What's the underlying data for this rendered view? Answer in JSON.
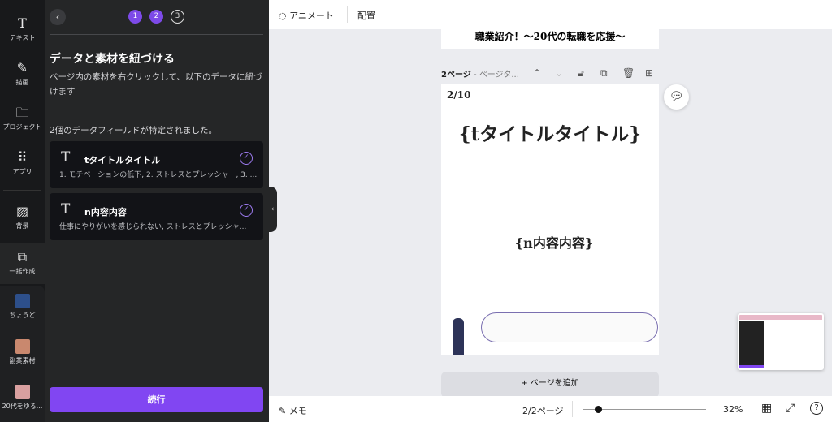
{
  "rail": [
    {
      "label": "テキスト",
      "icon": "text-icon"
    },
    {
      "label": "描画",
      "icon": "draw-icon"
    },
    {
      "label": "プロジェクト",
      "icon": "folder-icon"
    },
    {
      "label": "アプリ",
      "icon": "apps-icon"
    },
    {
      "label": "背景",
      "icon": "background-icon"
    },
    {
      "label": "一括作成",
      "icon": "bulk-create-icon"
    },
    {
      "label": "ちょうど",
      "icon": "app-thumbnail"
    },
    {
      "label": "副業素材",
      "icon": "app-thumbnail"
    },
    {
      "label": "20代をゆる...",
      "icon": "app-thumbnail"
    }
  ],
  "panel": {
    "steps": [
      "1",
      "2",
      "3"
    ],
    "title": "データと素材を紐づける",
    "description": "ページ内の素材を右クリックして、以下のデータに紐づけます",
    "found": "2個のデータフィールドが特定されました。",
    "fields": [
      {
        "name": "tタイトルタイトル",
        "preview": "1. モチベーションの低下, 2. ストレスとプレッシャー, 3. ..."
      },
      {
        "name": "n内容内容",
        "preview": "仕事にやりがいを感じられない, ストレスとプレッシャ..."
      }
    ],
    "continue_label": "続行"
  },
  "topbar": {
    "animate": "アニメート",
    "arrange": "配置"
  },
  "canvas": {
    "prev_page_title": "職業紹介！〜20代の転職を応援〜",
    "page_label": "2ページ",
    "page_title_placeholder": "ページタ...",
    "page_counter": "2/10",
    "title_placeholder": "{tタイトルタイトル}",
    "content_placeholder": "{n内容内容}",
    "add_page": "+ ページを追加"
  },
  "bottombar": {
    "notes": "メモ",
    "pages": "2/2ページ",
    "zoom": "32%",
    "zoom_percent": 32
  },
  "colors": {
    "accent": "#8146f2",
    "panel": "#252627",
    "rail": "#18191b"
  }
}
